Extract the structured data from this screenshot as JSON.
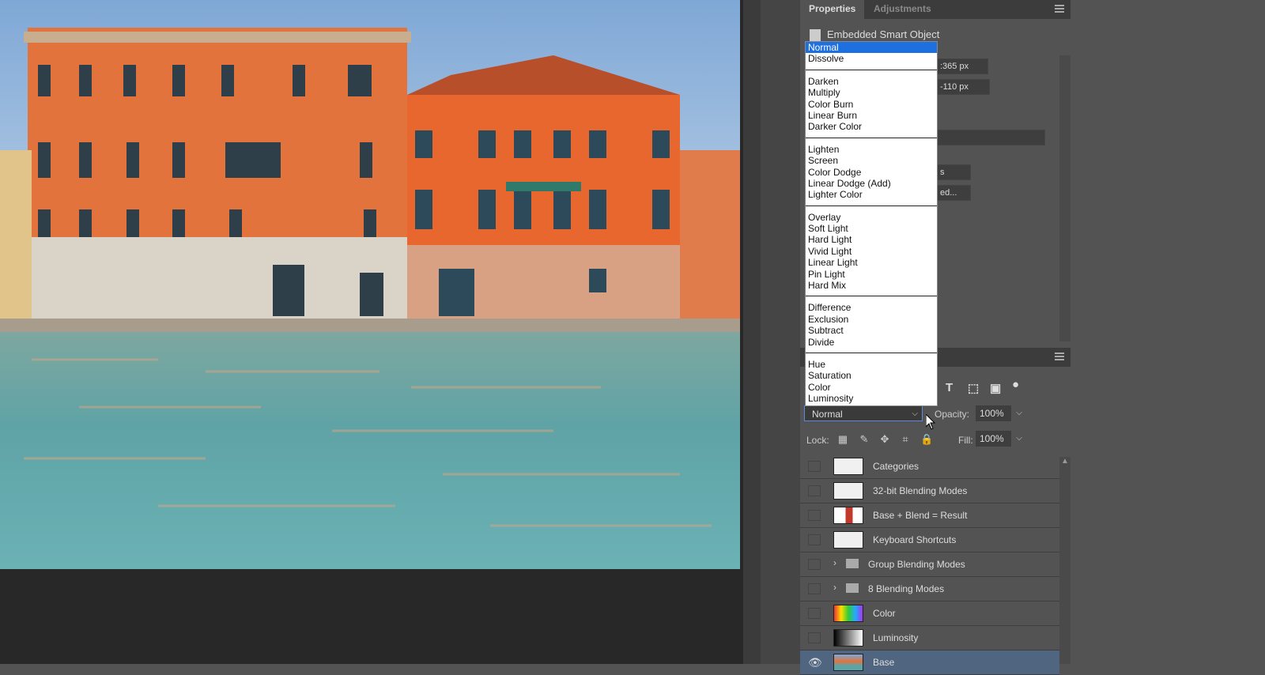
{
  "properties_panel": {
    "tabs": [
      "Properties",
      "Adjustments"
    ],
    "object_label": "Embedded Smart Object",
    "width_value": ":365 px",
    "y_value": "-110 px",
    "link_value": "ed...",
    "small_value": "s"
  },
  "blend_menu": {
    "groups": [
      [
        "Normal",
        "Dissolve"
      ],
      [
        "Darken",
        "Multiply",
        "Color Burn",
        "Linear Burn",
        "Darker Color"
      ],
      [
        "Lighten",
        "Screen",
        "Color Dodge",
        "Linear Dodge (Add)",
        "Lighter Color"
      ],
      [
        "Overlay",
        "Soft Light",
        "Hard Light",
        "Vivid Light",
        "Linear Light",
        "Pin Light",
        "Hard Mix"
      ],
      [
        "Difference",
        "Exclusion",
        "Subtract",
        "Divide"
      ],
      [
        "Hue",
        "Saturation",
        "Color",
        "Luminosity"
      ]
    ],
    "highlighted": "Normal"
  },
  "layers_panel": {
    "blend_mode": "Normal",
    "opacity_label": "Opacity:",
    "opacity_value": "100%",
    "lock_label": "Lock:",
    "fill_label": "Fill:",
    "fill_value": "100%",
    "layers": [
      {
        "name": "Categories",
        "kind": "layer",
        "visible": false,
        "selected": false
      },
      {
        "name": "32-bit Blending Modes",
        "kind": "layer",
        "visible": false,
        "selected": false
      },
      {
        "name": "Base + Blend = Result",
        "kind": "layer",
        "visible": false,
        "selected": false
      },
      {
        "name": "Keyboard Shortcuts",
        "kind": "layer",
        "visible": false,
        "selected": false
      },
      {
        "name": "Group Blending Modes",
        "kind": "group",
        "visible": false,
        "selected": false
      },
      {
        "name": "8 Blending Modes",
        "kind": "group",
        "visible": false,
        "selected": false
      },
      {
        "name": "Color",
        "kind": "layer",
        "visible": false,
        "selected": false
      },
      {
        "name": "Luminosity",
        "kind": "layer",
        "visible": false,
        "selected": false
      },
      {
        "name": "Base",
        "kind": "layer",
        "visible": true,
        "selected": true
      }
    ]
  },
  "colors": {
    "panel_bg": "#535353",
    "menu_highlight": "#1e6fe0",
    "selected_layer": "#4f6580"
  }
}
